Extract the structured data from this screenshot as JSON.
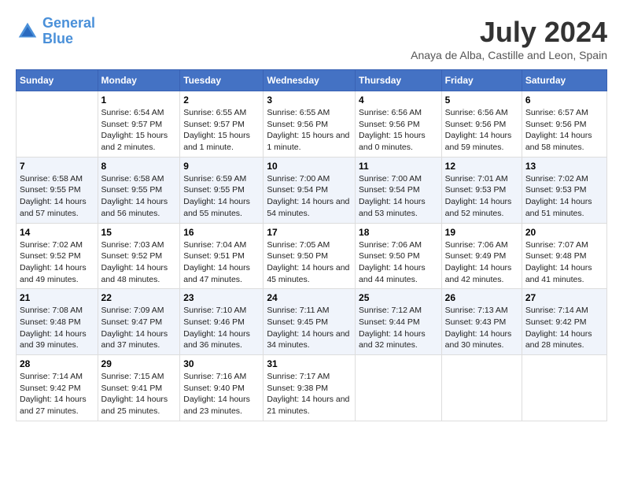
{
  "header": {
    "logo_line1": "General",
    "logo_line2": "Blue",
    "month_title": "July 2024",
    "location": "Anaya de Alba, Castille and Leon, Spain"
  },
  "weekdays": [
    "Sunday",
    "Monday",
    "Tuesday",
    "Wednesday",
    "Thursday",
    "Friday",
    "Saturday"
  ],
  "weeks": [
    [
      {
        "day": "",
        "sunrise": "",
        "sunset": "",
        "daylight": ""
      },
      {
        "day": "1",
        "sunrise": "Sunrise: 6:54 AM",
        "sunset": "Sunset: 9:57 PM",
        "daylight": "Daylight: 15 hours and 2 minutes."
      },
      {
        "day": "2",
        "sunrise": "Sunrise: 6:55 AM",
        "sunset": "Sunset: 9:57 PM",
        "daylight": "Daylight: 15 hours and 1 minute."
      },
      {
        "day": "3",
        "sunrise": "Sunrise: 6:55 AM",
        "sunset": "Sunset: 9:56 PM",
        "daylight": "Daylight: 15 hours and 1 minute."
      },
      {
        "day": "4",
        "sunrise": "Sunrise: 6:56 AM",
        "sunset": "Sunset: 9:56 PM",
        "daylight": "Daylight: 15 hours and 0 minutes."
      },
      {
        "day": "5",
        "sunrise": "Sunrise: 6:56 AM",
        "sunset": "Sunset: 9:56 PM",
        "daylight": "Daylight: 14 hours and 59 minutes."
      },
      {
        "day": "6",
        "sunrise": "Sunrise: 6:57 AM",
        "sunset": "Sunset: 9:56 PM",
        "daylight": "Daylight: 14 hours and 58 minutes."
      }
    ],
    [
      {
        "day": "7",
        "sunrise": "Sunrise: 6:58 AM",
        "sunset": "Sunset: 9:55 PM",
        "daylight": "Daylight: 14 hours and 57 minutes."
      },
      {
        "day": "8",
        "sunrise": "Sunrise: 6:58 AM",
        "sunset": "Sunset: 9:55 PM",
        "daylight": "Daylight: 14 hours and 56 minutes."
      },
      {
        "day": "9",
        "sunrise": "Sunrise: 6:59 AM",
        "sunset": "Sunset: 9:55 PM",
        "daylight": "Daylight: 14 hours and 55 minutes."
      },
      {
        "day": "10",
        "sunrise": "Sunrise: 7:00 AM",
        "sunset": "Sunset: 9:54 PM",
        "daylight": "Daylight: 14 hours and 54 minutes."
      },
      {
        "day": "11",
        "sunrise": "Sunrise: 7:00 AM",
        "sunset": "Sunset: 9:54 PM",
        "daylight": "Daylight: 14 hours and 53 minutes."
      },
      {
        "day": "12",
        "sunrise": "Sunrise: 7:01 AM",
        "sunset": "Sunset: 9:53 PM",
        "daylight": "Daylight: 14 hours and 52 minutes."
      },
      {
        "day": "13",
        "sunrise": "Sunrise: 7:02 AM",
        "sunset": "Sunset: 9:53 PM",
        "daylight": "Daylight: 14 hours and 51 minutes."
      }
    ],
    [
      {
        "day": "14",
        "sunrise": "Sunrise: 7:02 AM",
        "sunset": "Sunset: 9:52 PM",
        "daylight": "Daylight: 14 hours and 49 minutes."
      },
      {
        "day": "15",
        "sunrise": "Sunrise: 7:03 AM",
        "sunset": "Sunset: 9:52 PM",
        "daylight": "Daylight: 14 hours and 48 minutes."
      },
      {
        "day": "16",
        "sunrise": "Sunrise: 7:04 AM",
        "sunset": "Sunset: 9:51 PM",
        "daylight": "Daylight: 14 hours and 47 minutes."
      },
      {
        "day": "17",
        "sunrise": "Sunrise: 7:05 AM",
        "sunset": "Sunset: 9:50 PM",
        "daylight": "Daylight: 14 hours and 45 minutes."
      },
      {
        "day": "18",
        "sunrise": "Sunrise: 7:06 AM",
        "sunset": "Sunset: 9:50 PM",
        "daylight": "Daylight: 14 hours and 44 minutes."
      },
      {
        "day": "19",
        "sunrise": "Sunrise: 7:06 AM",
        "sunset": "Sunset: 9:49 PM",
        "daylight": "Daylight: 14 hours and 42 minutes."
      },
      {
        "day": "20",
        "sunrise": "Sunrise: 7:07 AM",
        "sunset": "Sunset: 9:48 PM",
        "daylight": "Daylight: 14 hours and 41 minutes."
      }
    ],
    [
      {
        "day": "21",
        "sunrise": "Sunrise: 7:08 AM",
        "sunset": "Sunset: 9:48 PM",
        "daylight": "Daylight: 14 hours and 39 minutes."
      },
      {
        "day": "22",
        "sunrise": "Sunrise: 7:09 AM",
        "sunset": "Sunset: 9:47 PM",
        "daylight": "Daylight: 14 hours and 37 minutes."
      },
      {
        "day": "23",
        "sunrise": "Sunrise: 7:10 AM",
        "sunset": "Sunset: 9:46 PM",
        "daylight": "Daylight: 14 hours and 36 minutes."
      },
      {
        "day": "24",
        "sunrise": "Sunrise: 7:11 AM",
        "sunset": "Sunset: 9:45 PM",
        "daylight": "Daylight: 14 hours and 34 minutes."
      },
      {
        "day": "25",
        "sunrise": "Sunrise: 7:12 AM",
        "sunset": "Sunset: 9:44 PM",
        "daylight": "Daylight: 14 hours and 32 minutes."
      },
      {
        "day": "26",
        "sunrise": "Sunrise: 7:13 AM",
        "sunset": "Sunset: 9:43 PM",
        "daylight": "Daylight: 14 hours and 30 minutes."
      },
      {
        "day": "27",
        "sunrise": "Sunrise: 7:14 AM",
        "sunset": "Sunset: 9:42 PM",
        "daylight": "Daylight: 14 hours and 28 minutes."
      }
    ],
    [
      {
        "day": "28",
        "sunrise": "Sunrise: 7:14 AM",
        "sunset": "Sunset: 9:42 PM",
        "daylight": "Daylight: 14 hours and 27 minutes."
      },
      {
        "day": "29",
        "sunrise": "Sunrise: 7:15 AM",
        "sunset": "Sunset: 9:41 PM",
        "daylight": "Daylight: 14 hours and 25 minutes."
      },
      {
        "day": "30",
        "sunrise": "Sunrise: 7:16 AM",
        "sunset": "Sunset: 9:40 PM",
        "daylight": "Daylight: 14 hours and 23 minutes."
      },
      {
        "day": "31",
        "sunrise": "Sunrise: 7:17 AM",
        "sunset": "Sunset: 9:38 PM",
        "daylight": "Daylight: 14 hours and 21 minutes."
      },
      {
        "day": "",
        "sunrise": "",
        "sunset": "",
        "daylight": ""
      },
      {
        "day": "",
        "sunrise": "",
        "sunset": "",
        "daylight": ""
      },
      {
        "day": "",
        "sunrise": "",
        "sunset": "",
        "daylight": ""
      }
    ]
  ]
}
